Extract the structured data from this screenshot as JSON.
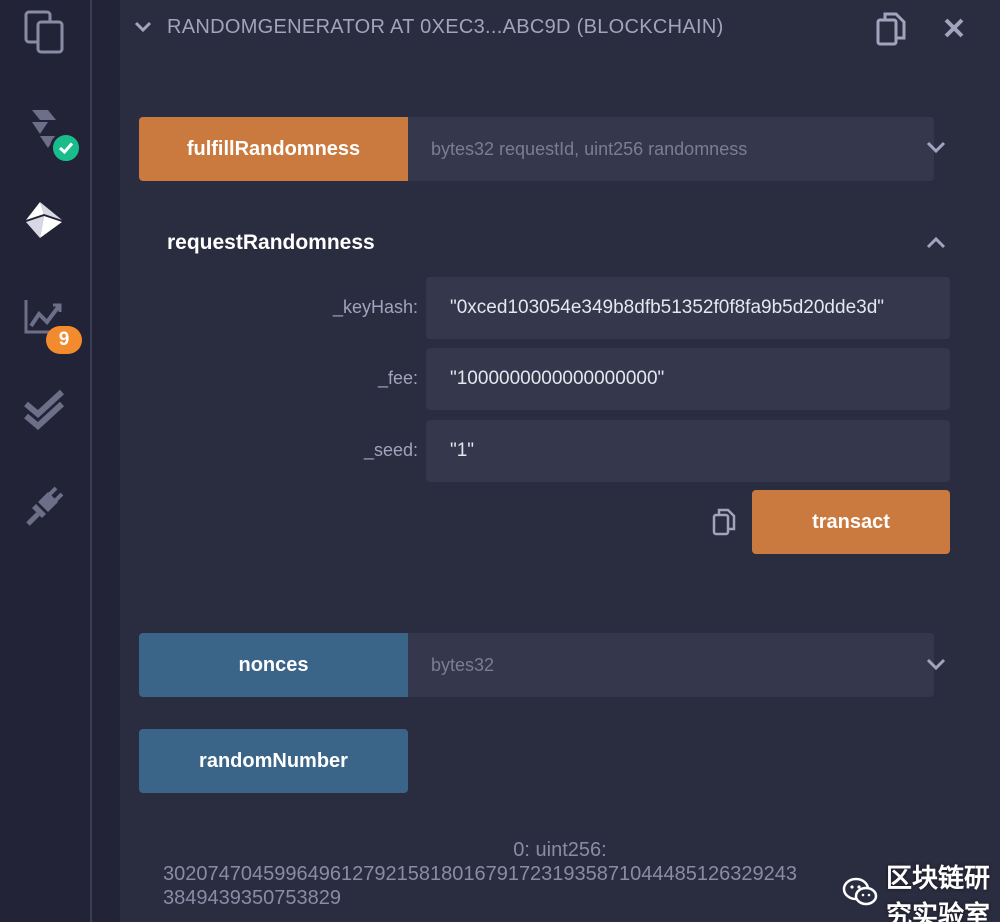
{
  "sidebar": {
    "icons": [
      "files-icon",
      "compiler-icon",
      "deploy-run-icon",
      "analysis-icon",
      "tests-icon",
      "plugin-icon"
    ],
    "analysis_badge": "9"
  },
  "header": {
    "title": "RANDOMGENERATOR AT 0XEC3...ABC9D (BLOCKCHAIN)"
  },
  "functions": {
    "fulfill": {
      "label": "fulfillRandomness",
      "placeholder": "bytes32 requestId, uint256 randomness"
    },
    "request": {
      "title": "requestRandomness",
      "params": [
        {
          "label": "_keyHash:",
          "value": "\"0xced103054e349b8dfb51352f0f8fa9b5d20dde3d\""
        },
        {
          "label": "_fee:",
          "value": "\"1000000000000000000\""
        },
        {
          "label": "_seed:",
          "value": "\"1\""
        }
      ],
      "transact_label": "transact"
    },
    "nonces": {
      "label": "nonces",
      "placeholder": "bytes32"
    },
    "randomNumber": {
      "label": "randomNumber"
    }
  },
  "result": {
    "line1": "0: uint256:",
    "line2": "302074704599649612792158180167917231935871044485126329243",
    "line3": "3849439350753829"
  },
  "watermark": {
    "text": "区块链研究实验室"
  },
  "colors": {
    "orange": "#cb7a3f",
    "blue": "#3b6588",
    "background": "#2a2c3f",
    "sidebar": "#222336",
    "badge_green": "#1abc8c",
    "badge_orange": "#f28a2e"
  }
}
